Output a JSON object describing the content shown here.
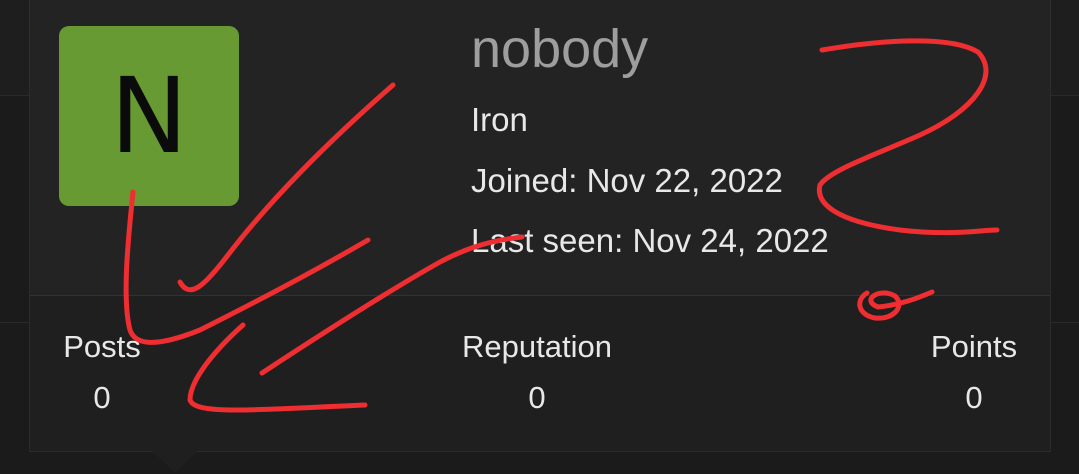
{
  "profile": {
    "avatar_letter": "N",
    "avatar_color": "#679a33",
    "username": "nobody",
    "rank": "Iron",
    "joined": "Joined: Nov 22, 2022",
    "last_seen": "Last seen: Nov 24, 2022"
  },
  "stats": [
    {
      "label": "Posts",
      "value": "0"
    },
    {
      "label": "Reputation",
      "value": "0"
    },
    {
      "label": "Points",
      "value": "0"
    }
  ],
  "colors": {
    "card_bg": "#232323",
    "stats_bg": "#1f1f1f",
    "username_text": "#9e9e9e",
    "body_text": "#e8e8e8",
    "annotation_ink": "#ee2e31"
  }
}
